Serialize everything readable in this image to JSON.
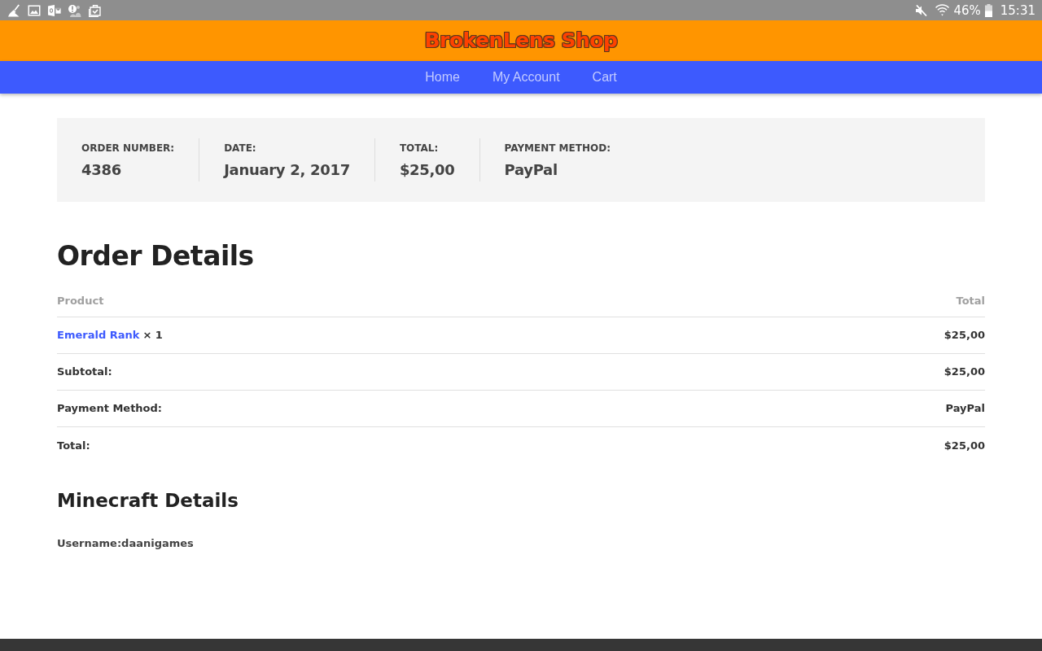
{
  "status_bar": {
    "battery": "46%",
    "time": "15:31"
  },
  "header": {
    "title": "BrokenLens Shop"
  },
  "nav": {
    "items": [
      {
        "label": "Home"
      },
      {
        "label": "My Account"
      },
      {
        "label": "Cart"
      }
    ]
  },
  "order_summary": {
    "items": [
      {
        "label": "ORDER NUMBER:",
        "value": "4386"
      },
      {
        "label": "DATE:",
        "value": "January 2, 2017"
      },
      {
        "label": "TOTAL:",
        "value": "$25,00"
      },
      {
        "label": "PAYMENT METHOD:",
        "value": "PayPal"
      }
    ]
  },
  "order_details": {
    "title": "Order Details",
    "columns": [
      "Product",
      "Total"
    ],
    "rows": [
      {
        "kind": "product",
        "product": "Emerald Rank",
        "quantity": "× 1",
        "total": "$25,00"
      },
      {
        "kind": "summary",
        "label": "Subtotal:",
        "value": "$25,00"
      },
      {
        "kind": "summary",
        "label": "Payment Method:",
        "value": "PayPal"
      },
      {
        "kind": "summary",
        "label": "Total:",
        "value": "$25,00"
      }
    ]
  },
  "minecraft_details": {
    "title": "Minecraft Details",
    "text": "Username:daanigames"
  }
}
